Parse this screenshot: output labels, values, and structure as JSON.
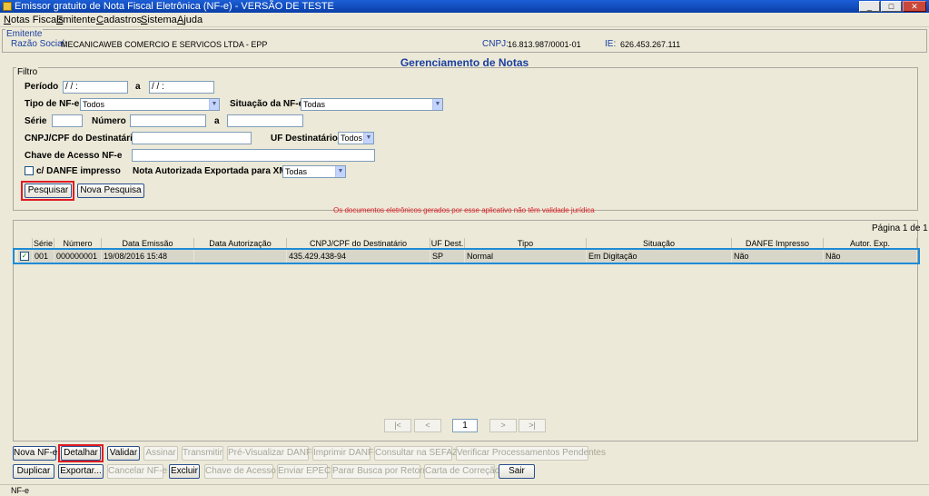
{
  "window": {
    "title": "Emissor gratuito de Nota Fiscal Eletrônica (NF-e) - VERSÃO DE TESTE"
  },
  "menu": [
    {
      "first": "N",
      "rest": "otas Fiscais"
    },
    {
      "first": "E",
      "rest": "mitente"
    },
    {
      "first": "C",
      "rest": "adastros"
    },
    {
      "first": "S",
      "rest": "istema"
    },
    {
      "first": "A",
      "rest": "juda"
    }
  ],
  "emitente": {
    "legend": "Emitente",
    "razao_label": "Razão Social:",
    "razao_value": "MECANICAWEB COMERCIO E SERVICOS LTDA - EPP",
    "cnpj_label": "CNPJ:",
    "cnpj_value": "16.813.987/0001-01",
    "ie_label": "IE:",
    "ie_value": "626.453.267.111"
  },
  "main": {
    "title": "Gerenciamento de Notas"
  },
  "filtro": {
    "legend": "Filtro",
    "periodo_label": "Período",
    "periodo_from": "  /  /     :  ",
    "periodo_sep": "a",
    "periodo_to": "  /  /     :  ",
    "tipo_label": "Tipo de NF-e",
    "tipo_value": "Todos",
    "situacao_label": "Situação da NF-e",
    "situacao_value": "Todas",
    "serie_label": "Série",
    "numero_label": "Número",
    "numero_sep": "a",
    "cnpj_label": "CNPJ/CPF do Destinatário",
    "uf_label": "UF Destinatário",
    "uf_value": "Todos",
    "chave_label": "Chave de Acesso NF-e",
    "danfe_label": "c/ DANFE impresso",
    "xml_label": "Nota Autorizada Exportada para XML",
    "xml_value": "Todas",
    "pesquisar": "Pesquisar",
    "nova_pesquisa": "Nova Pesquisa",
    "warning": "Os documentos eletrônicos gerados por esse aplicativo não têm validade jurídica"
  },
  "table": {
    "pagina": "Página 1 de 1",
    "columns": [
      "Série",
      "Número",
      "Data Emissão",
      "Data Autorização",
      "CNPJ/CPF do Destinatário",
      "UF Dest.",
      "Tipo",
      "Situação",
      "DANFE Impresso",
      "Autor. Exp."
    ],
    "rows": [
      {
        "serie": "001",
        "numero": "000000001",
        "emissao": "19/08/2016 15:48",
        "autorizacao": "",
        "cnpj": "435.429.438-94",
        "uf": "SP",
        "tipo": "Normal",
        "situacao": "Em Digitação",
        "danfe": "Não",
        "autor_exp": "Não"
      }
    ]
  },
  "pagination": {
    "first": "|<",
    "prev": "<",
    "page": "1",
    "next": ">",
    "last": ">|"
  },
  "actions_row1": [
    "Nova NF-e",
    "Detalhar",
    "Validar",
    "Assinar",
    "Transmitir",
    "Pré-Visualizar DANFE",
    "Imprimir DANFE",
    "Consultar na SEFAZ",
    "Verificar Processamentos Pendentes"
  ],
  "actions_row2": [
    "Duplicar",
    "Exportar...",
    "Cancelar NF-e",
    "Excluir",
    "Chave de Acesso",
    "Enviar EPEC",
    "Parar Busca por Retorno",
    "Carta de Correção",
    "Sair"
  ],
  "status": "NF-e"
}
